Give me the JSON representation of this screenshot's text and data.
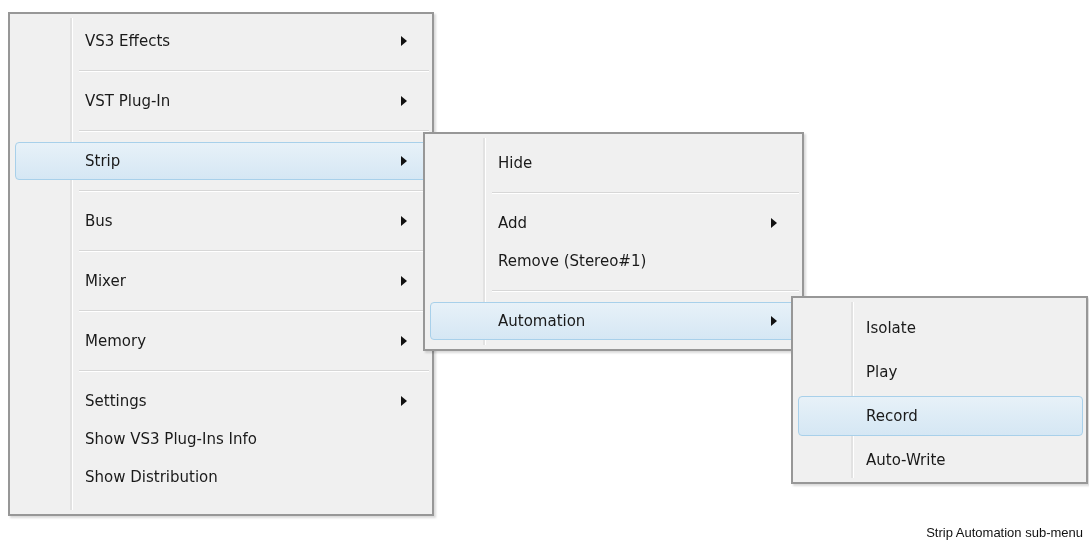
{
  "menus": [
    {
      "items": [
        {
          "label": "VS3 Effects",
          "submenu": true,
          "selected": false,
          "separator_after": true
        },
        {
          "label": "VST Plug-In",
          "submenu": true,
          "selected": false,
          "separator_after": true
        },
        {
          "label": "Strip",
          "submenu": true,
          "selected": true,
          "separator_after": true
        },
        {
          "label": "Bus",
          "submenu": true,
          "selected": false,
          "separator_after": true
        },
        {
          "label": "Mixer",
          "submenu": true,
          "selected": false,
          "separator_after": true
        },
        {
          "label": "Memory",
          "submenu": true,
          "selected": false,
          "separator_after": true
        },
        {
          "label": "Settings",
          "submenu": true,
          "selected": false,
          "separator_after": false
        },
        {
          "label": "Show VS3 Plug-Ins Info",
          "submenu": false,
          "selected": false,
          "separator_after": false
        },
        {
          "label": "Show Distribution",
          "submenu": false,
          "selected": false,
          "separator_after": false
        }
      ]
    },
    {
      "items": [
        {
          "label": "Hide",
          "submenu": false,
          "selected": false,
          "separator_after": true
        },
        {
          "label": "Add",
          "submenu": true,
          "selected": false,
          "separator_after": false
        },
        {
          "label": "Remove (Stereo#1)",
          "submenu": false,
          "selected": false,
          "separator_after": true
        },
        {
          "label": "Automation",
          "submenu": true,
          "selected": true,
          "separator_after": false
        }
      ]
    },
    {
      "items": [
        {
          "label": "Isolate",
          "submenu": false,
          "selected": false,
          "separator_after": false
        },
        {
          "label": "Play",
          "submenu": false,
          "selected": false,
          "separator_after": false
        },
        {
          "label": "Record",
          "submenu": false,
          "selected": true,
          "separator_after": false
        },
        {
          "label": "Auto-Write",
          "submenu": false,
          "selected": false,
          "separator_after": false
        }
      ]
    }
  ],
  "caption": "Strip Automation sub-menu"
}
